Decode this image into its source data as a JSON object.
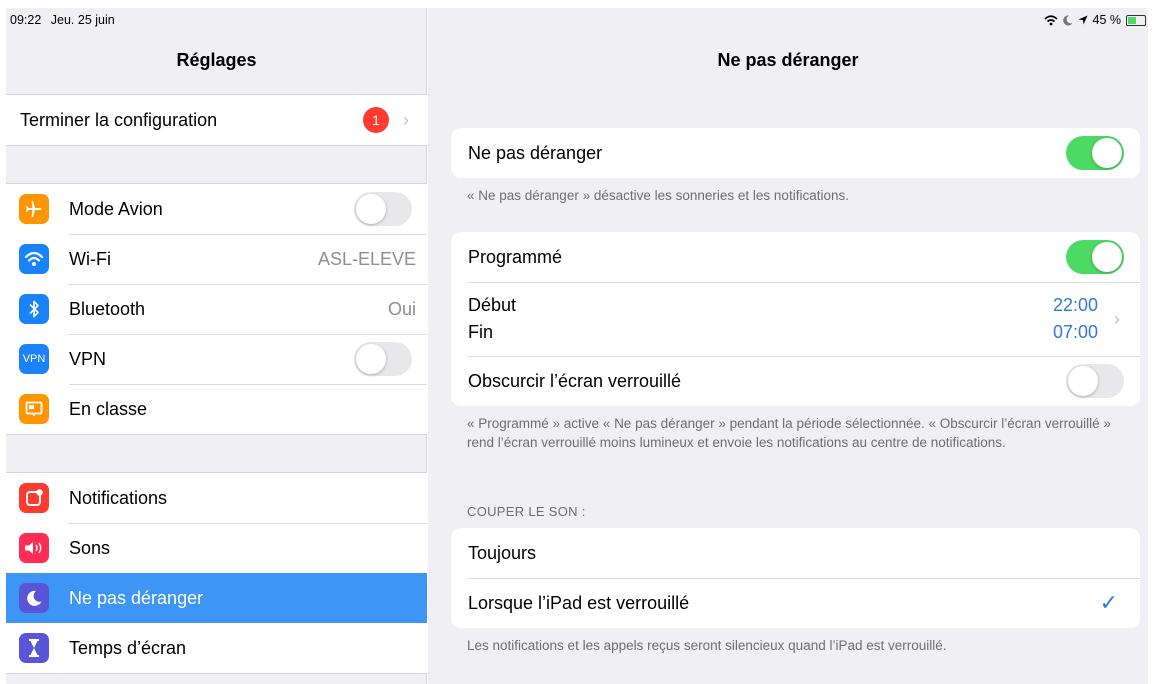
{
  "status": {
    "time": "09:22",
    "date": "Jeu. 25 juin",
    "battery": "45 %",
    "icons": [
      "wifi-icon",
      "moon-icon",
      "location-arrow-icon",
      "battery-icon"
    ]
  },
  "sidebar": {
    "title": "Réglages",
    "setup": {
      "label": "Terminer la configuration",
      "badge": "1"
    },
    "group1": [
      {
        "label": "Mode Avion",
        "icon": "airplane-icon",
        "color": "#ff9500",
        "control": "toggle",
        "on": false
      },
      {
        "label": "Wi-Fi",
        "icon": "wifi-icon",
        "color": "#1a82fb",
        "value": "ASL-ELEVE"
      },
      {
        "label": "Bluetooth",
        "icon": "bluetooth-icon",
        "color": "#1a82fb",
        "value": "Oui"
      },
      {
        "label": "VPN",
        "icon": "vpn-icon",
        "icon_text": "VPN",
        "color": "#1a82fb",
        "control": "toggle",
        "on": false
      },
      {
        "label": "En classe",
        "icon": "classroom-icon",
        "color": "#ff9500"
      }
    ],
    "group2": [
      {
        "label": "Notifications",
        "icon": "notifications-icon",
        "color": "#ff3b30"
      },
      {
        "label": "Sons",
        "icon": "speaker-icon",
        "color": "#ff2d55"
      },
      {
        "label": "Ne pas déranger",
        "icon": "moon-icon",
        "color": "#5856d6",
        "selected": true
      },
      {
        "label": "Temps d’écran",
        "icon": "hourglass-icon",
        "color": "#5856d6"
      }
    ]
  },
  "detail": {
    "title": "Ne pas déranger",
    "dnd": {
      "label": "Ne pas déranger",
      "on": true
    },
    "dnd_note": "« Ne pas déranger » désactive les sonneries et les notifications.",
    "scheduled": {
      "label": "Programmé",
      "on": true
    },
    "start_label": "Début",
    "end_label": "Fin",
    "start_time": "22:00",
    "end_time": "07:00",
    "dim_lock": {
      "label": "Obscurcir l’écran verrouillé",
      "on": false
    },
    "scheduled_note": "« Programmé » active « Ne pas déranger » pendant la période sélectionnée. « Obscurcir l’écran verrouillé » rend l’écran verrouillé moins lumineux et envoie les notifications au centre de notifications.",
    "silence_header": "COUPER LE SON :",
    "silence_options": [
      {
        "label": "Toujours",
        "checked": false
      },
      {
        "label": "Lorsque l’iPad est verrouillé",
        "checked": true
      }
    ],
    "silence_note": "Les notifications et les appels reçus seront silencieux quand l’iPad est verrouillé."
  }
}
